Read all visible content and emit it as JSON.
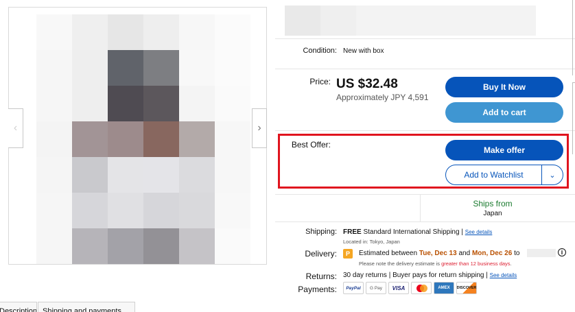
{
  "gallery": {
    "prev_icon": "chevron-left-icon",
    "next_icon": "chevron-right-icon",
    "pixel_colors": [
      [
        "#f8f8f8",
        "#efefef",
        "#e6e6e6",
        "#eeeeee",
        "#f7f7f7",
        "#fbfbfb"
      ],
      [
        "#f6f6f6",
        "#eeeeee",
        "#60636a",
        "#7d7e82",
        "#f8f8f8",
        "#fbfbfb"
      ],
      [
        "#f6f6f6",
        "#eeeeee",
        "#4f4b52",
        "#5c575c",
        "#f4f4f4",
        "#fafafa"
      ],
      [
        "#f4f4f4",
        "#a29496",
        "#9d8b8c",
        "#88675f",
        "#b3aaa9",
        "#f7f7f7"
      ],
      [
        "#f5f5f5",
        "#c9c9cd",
        "#e4e4e7",
        "#e4e4e8",
        "#dbdbde",
        "#f7f7f7"
      ],
      [
        "#f6f6f6",
        "#d6d6da",
        "#e0e0e3",
        "#d6d6da",
        "#d9d9dc",
        "#f8f8f8"
      ],
      [
        "#f6f6f6",
        "#b6b4b9",
        "#a3a2a8",
        "#939196",
        "#c5c3c7",
        "#fafafa"
      ]
    ]
  },
  "item": {
    "condition_label": "Condition:",
    "condition_value": "New with box",
    "price_label": "Price:",
    "price": "US $32.48",
    "price_approx": "Approximately JPY 4,591",
    "best_offer_label": "Best Offer:"
  },
  "actions": {
    "buy_now": "Buy It Now",
    "add_to_cart": "Add to cart",
    "make_offer": "Make offer",
    "watchlist": "Add to Watchlist",
    "watchlist_dropdown_icon": "chevron-down-icon"
  },
  "ships_from": {
    "title": "Ships from",
    "country": "Japan"
  },
  "shipping": {
    "label": "Shipping:",
    "free": "FREE",
    "method": "Standard International Shipping",
    "separator": "|",
    "details_link": "See details",
    "location": "Located in: Tokyo, Japan"
  },
  "delivery": {
    "label": "Delivery:",
    "icon": "shipping-badge-icon",
    "icon_glyph": "P",
    "text_prefix": "Estimated between",
    "date_start": "Tue, Dec 13",
    "text_and": "and",
    "date_end": "Mon, Dec 26",
    "text_to": "to",
    "note_prefix": "Please note the delivery estimate is",
    "note_highlight": "greater than 12 business days",
    "note_suffix": ".",
    "info_icon": "info-icon",
    "info_glyph": "i"
  },
  "returns": {
    "label": "Returns:",
    "text": "30 day returns | Buyer pays for return shipping |",
    "details_link": "See details"
  },
  "payments": {
    "label": "Payments:",
    "methods": [
      "PayPal",
      "G Pay",
      "VISA",
      "Mastercard",
      "AMEX",
      "DISCOVER"
    ]
  },
  "tabs": {
    "description": "Description",
    "shipping_payments": "Shipping and payments"
  },
  "colors": {
    "primary_button": "#0654ba",
    "secondary_button": "#3f96d2",
    "highlight_border": "#e0141e",
    "ships_from_text": "#1a7a2e",
    "date_highlight": "#b95000"
  }
}
